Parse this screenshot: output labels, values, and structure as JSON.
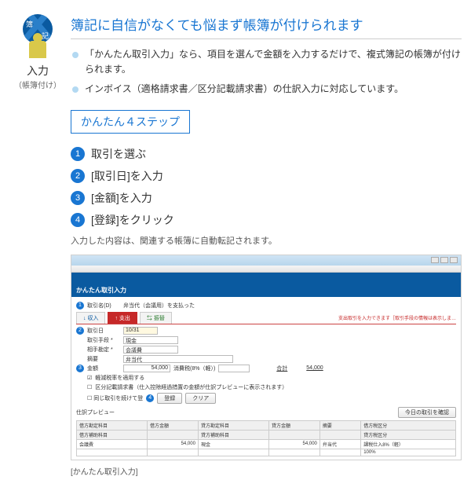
{
  "sidebar": {
    "logo_char1": "簿",
    "logo_char2": "記",
    "label": "入力",
    "sublabel": "（帳簿付け）"
  },
  "heading": "簿記に自信がなくても悩まず帳簿が付けられます",
  "bullets": [
    "「かんたん取引入力」なら、項目を選んで金額を入力するだけで、複式簿記の帳簿が付けられます。",
    "インボイス（適格請求書／区分記載請求書）の仕訳入力に対応しています。"
  ],
  "step_badge": "かんたん４ステップ",
  "steps": [
    "取引を選ぶ",
    "[取引日]を入力",
    "[金額]を入力",
    "[登録]をクリック"
  ],
  "note": "入力した内容は、関連する帳簿に自動転記されます。",
  "screenshot": {
    "panel_title": "かんたん取引入力",
    "row_torihiki_name_label": "取引名(D)",
    "row_torihiki_name_value": "弁当代（会議用）を支払った",
    "tab_income": "収入",
    "tab_expense": "支出",
    "tab_transfer": "振替",
    "red_note": "支出取引を入力できます［取引手段の情報は表示しま…",
    "row_date_label": "取引日",
    "row_date_value": "10/31",
    "row_means_label": "取引手段 *",
    "row_means_value": "現金",
    "row_against_label": "相手勘定 *",
    "row_against_value": "会議費",
    "row_summary_label": "摘要",
    "row_summary_value": "弁当代",
    "row_amount_label": "金額",
    "row_amount_value": "54,000",
    "row_tax_label": "消費税(8%（軽）)",
    "row_total_label": "合計",
    "row_total_value": "54,000",
    "check1": "軽減税率を適用する",
    "check2": "区分記載請求書（仕入控除経過措置の金額が仕訳プレビューに表示されます）",
    "check3": "同じ取引を続けて登",
    "btn_register": "登録",
    "btn_clear": "クリア",
    "preview_label": "仕訳プレビュー",
    "btn_today": "今日の取引を確認",
    "table": {
      "headers": [
        "借方勘定科目",
        "借方補助科目",
        "借方金額",
        "貸方勘定科目",
        "貸方補助科目",
        "貸方金額",
        "摘要",
        "借方税区分",
        "貸方税区分"
      ],
      "r1": [
        "会議費",
        "",
        "54,000",
        "現金",
        "",
        "54,000",
        "弁当代",
        "課税仕入8%（軽）",
        "100%"
      ]
    }
  },
  "caption": "[かんたん取引入力]"
}
